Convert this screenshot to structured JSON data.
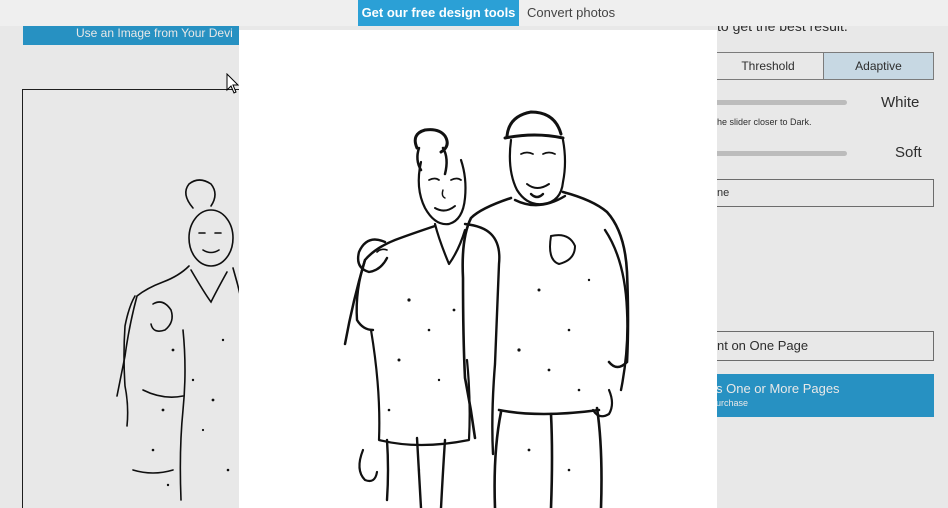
{
  "topbar": {
    "primary_label": "Get our free design tools",
    "secondary_label": "Convert photos"
  },
  "background": {
    "upload_button_label": "Use an Image from Your Devi",
    "hint_top": "to get the best result.",
    "modes": [
      "Threshold",
      "Adaptive"
    ],
    "slider1_end_label": "White",
    "slider_hint": "g the slider closer to Dark.",
    "slider2_end_label": "Soft",
    "select_value": "ne",
    "print_button_label": "nt on One Page",
    "buy_button_label": "s One or More Pages",
    "buy_button_sublabel": "urchase"
  },
  "colors": {
    "accent": "#2ba0d6",
    "adaptive_selected": "#dbeefa"
  },
  "modal": {
    "image_description": "black and white sketch of two people"
  }
}
